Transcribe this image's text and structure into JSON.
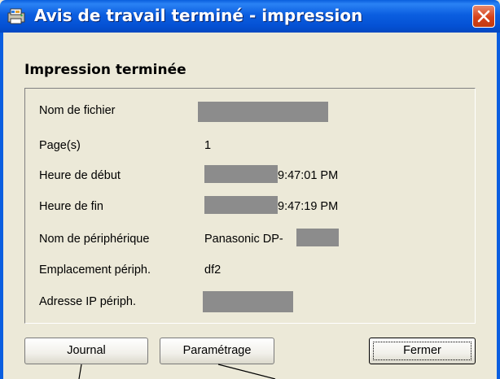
{
  "window": {
    "title": "Avis de travail terminé - impression",
    "app_icon": "printer-app-icon",
    "close_icon": "close-x-icon"
  },
  "heading": "Impression terminée",
  "fields": [
    {
      "label": "Nom de fichier",
      "value": ""
    },
    {
      "label": "Page(s)",
      "value": "1"
    },
    {
      "label": "Heure de début",
      "value": "9:47:01 PM"
    },
    {
      "label": "Heure de fin",
      "value": "9:47:19 PM"
    },
    {
      "label": "Nom de périphérique",
      "value": "Panasonic DP-"
    },
    {
      "label": "Emplacement périph.",
      "value": "df2"
    },
    {
      "label": "Adresse IP périph.",
      "value": ""
    }
  ],
  "buttons": {
    "journal": "Journal",
    "parametrage": "Paramétrage",
    "fermer": "Fermer"
  },
  "colors": {
    "titlebar": "#0b5ee0",
    "dialog_bg": "#ece9d8",
    "close_button": "#d6421a",
    "redaction": "#8c8c8c"
  }
}
